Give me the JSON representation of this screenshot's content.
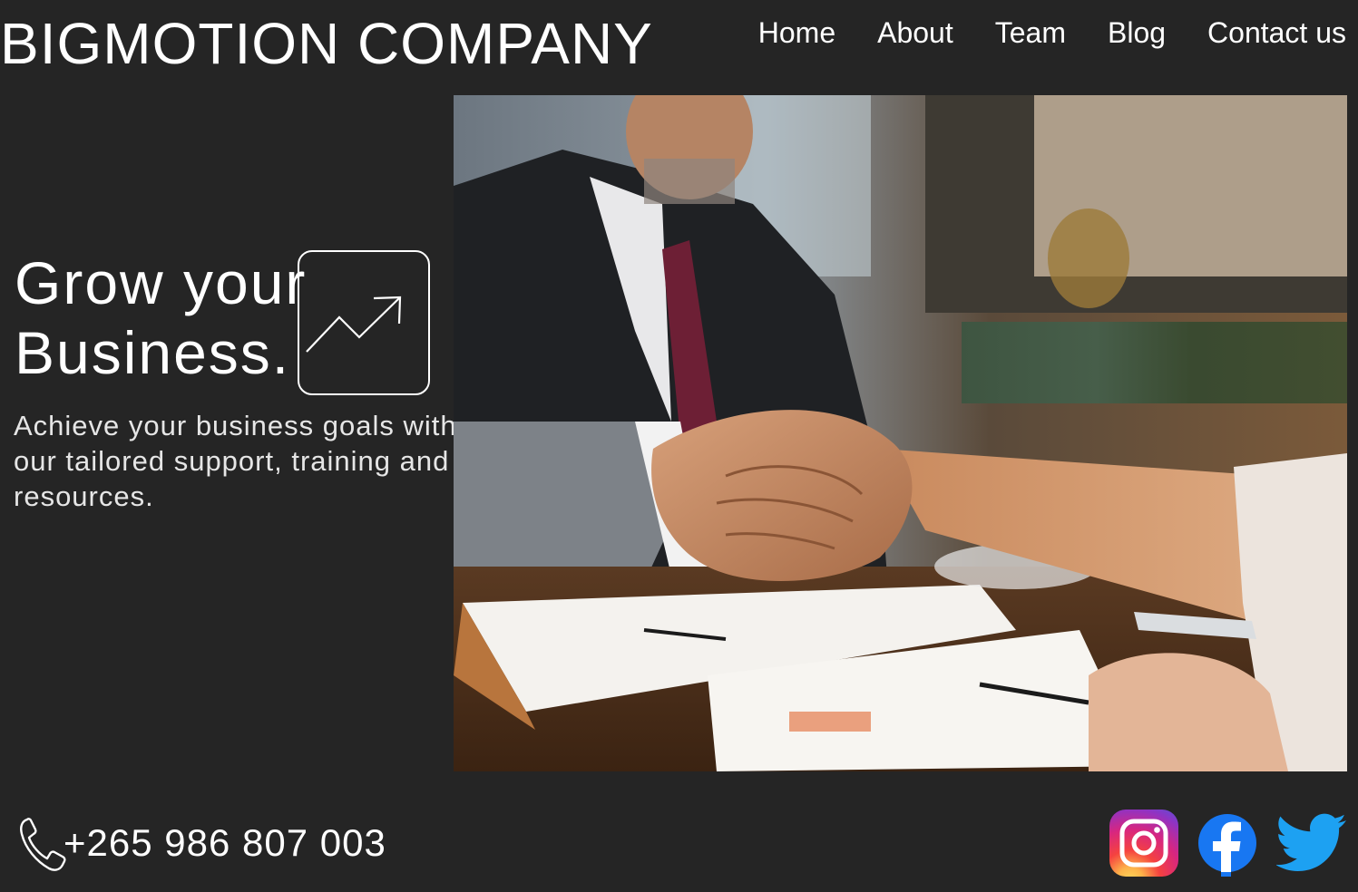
{
  "header": {
    "brand": "BIGMOTION COMPANY",
    "nav": [
      "Home",
      "About",
      "Team",
      "Blog",
      "Contact us"
    ]
  },
  "hero": {
    "title_line1": "Grow your",
    "title_line2": "Business.",
    "trend_icon": "trending-up-icon",
    "description": "Achieve your business goals with our tailored support, training and resources."
  },
  "image": {
    "subject": "handshake-photo"
  },
  "contact": {
    "phone_icon": "phone-icon",
    "phone": "+265 986 807 003"
  },
  "social": {
    "icons": [
      "instagram-icon",
      "facebook-icon",
      "twitter-icon"
    ]
  },
  "colors": {
    "background": "#252525",
    "text": "#ffffff",
    "facebook": "#1877F2",
    "twitter": "#1DA1F2"
  }
}
